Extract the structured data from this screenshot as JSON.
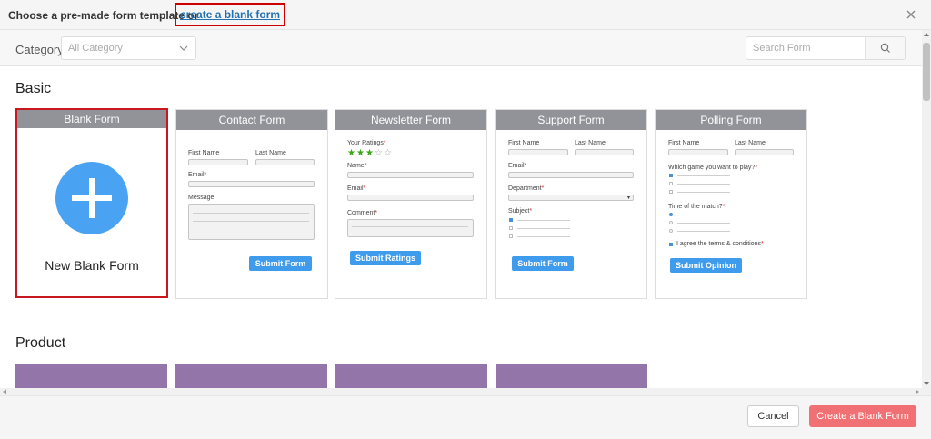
{
  "header": {
    "text": "Choose a pre-made form template or",
    "link": "create a blank form"
  },
  "toolbar": {
    "category_label": "Category",
    "category_value": "All Category",
    "search_placeholder": "Search Form"
  },
  "sections": {
    "basic": "Basic",
    "product": "Product"
  },
  "cards": {
    "blank": {
      "title": "Blank Form",
      "text": "New Blank Form"
    },
    "contact": {
      "title": "Contact Form",
      "first_name": "First Name",
      "last_name": "Last Name",
      "email": "Email",
      "message": "Message",
      "button": "Submit Form"
    },
    "newsletter": {
      "title": "Newsletter Form",
      "ratings": "Your Ratings",
      "name": "Name",
      "email": "Email",
      "comment": "Comment",
      "button": "Submit Ratings",
      "rating_value": 3,
      "rating_max": 5
    },
    "support": {
      "title": "Support Form",
      "first_name": "First Name",
      "last_name": "Last Name",
      "email": "Email",
      "department": "Department",
      "subject": "Subject",
      "button": "Submit Form"
    },
    "polling": {
      "title": "Polling Form",
      "first_name": "First Name",
      "last_name": "Last Name",
      "question": "Which game you want to play?",
      "time": "Time of the match?",
      "agree": "I agree the terms & conditions",
      "button": "Submit Opinion"
    }
  },
  "footer": {
    "cancel": "Cancel",
    "create": "Create a Blank Form"
  },
  "colors": {
    "card_header": "#919399",
    "accent_blue": "#4aa3f2",
    "submit_blue": "#3f9bec",
    "highlight_red": "#c8171e",
    "create_button": "#f17073",
    "product_card": "#9375a9",
    "star_green": "#3aa717"
  }
}
